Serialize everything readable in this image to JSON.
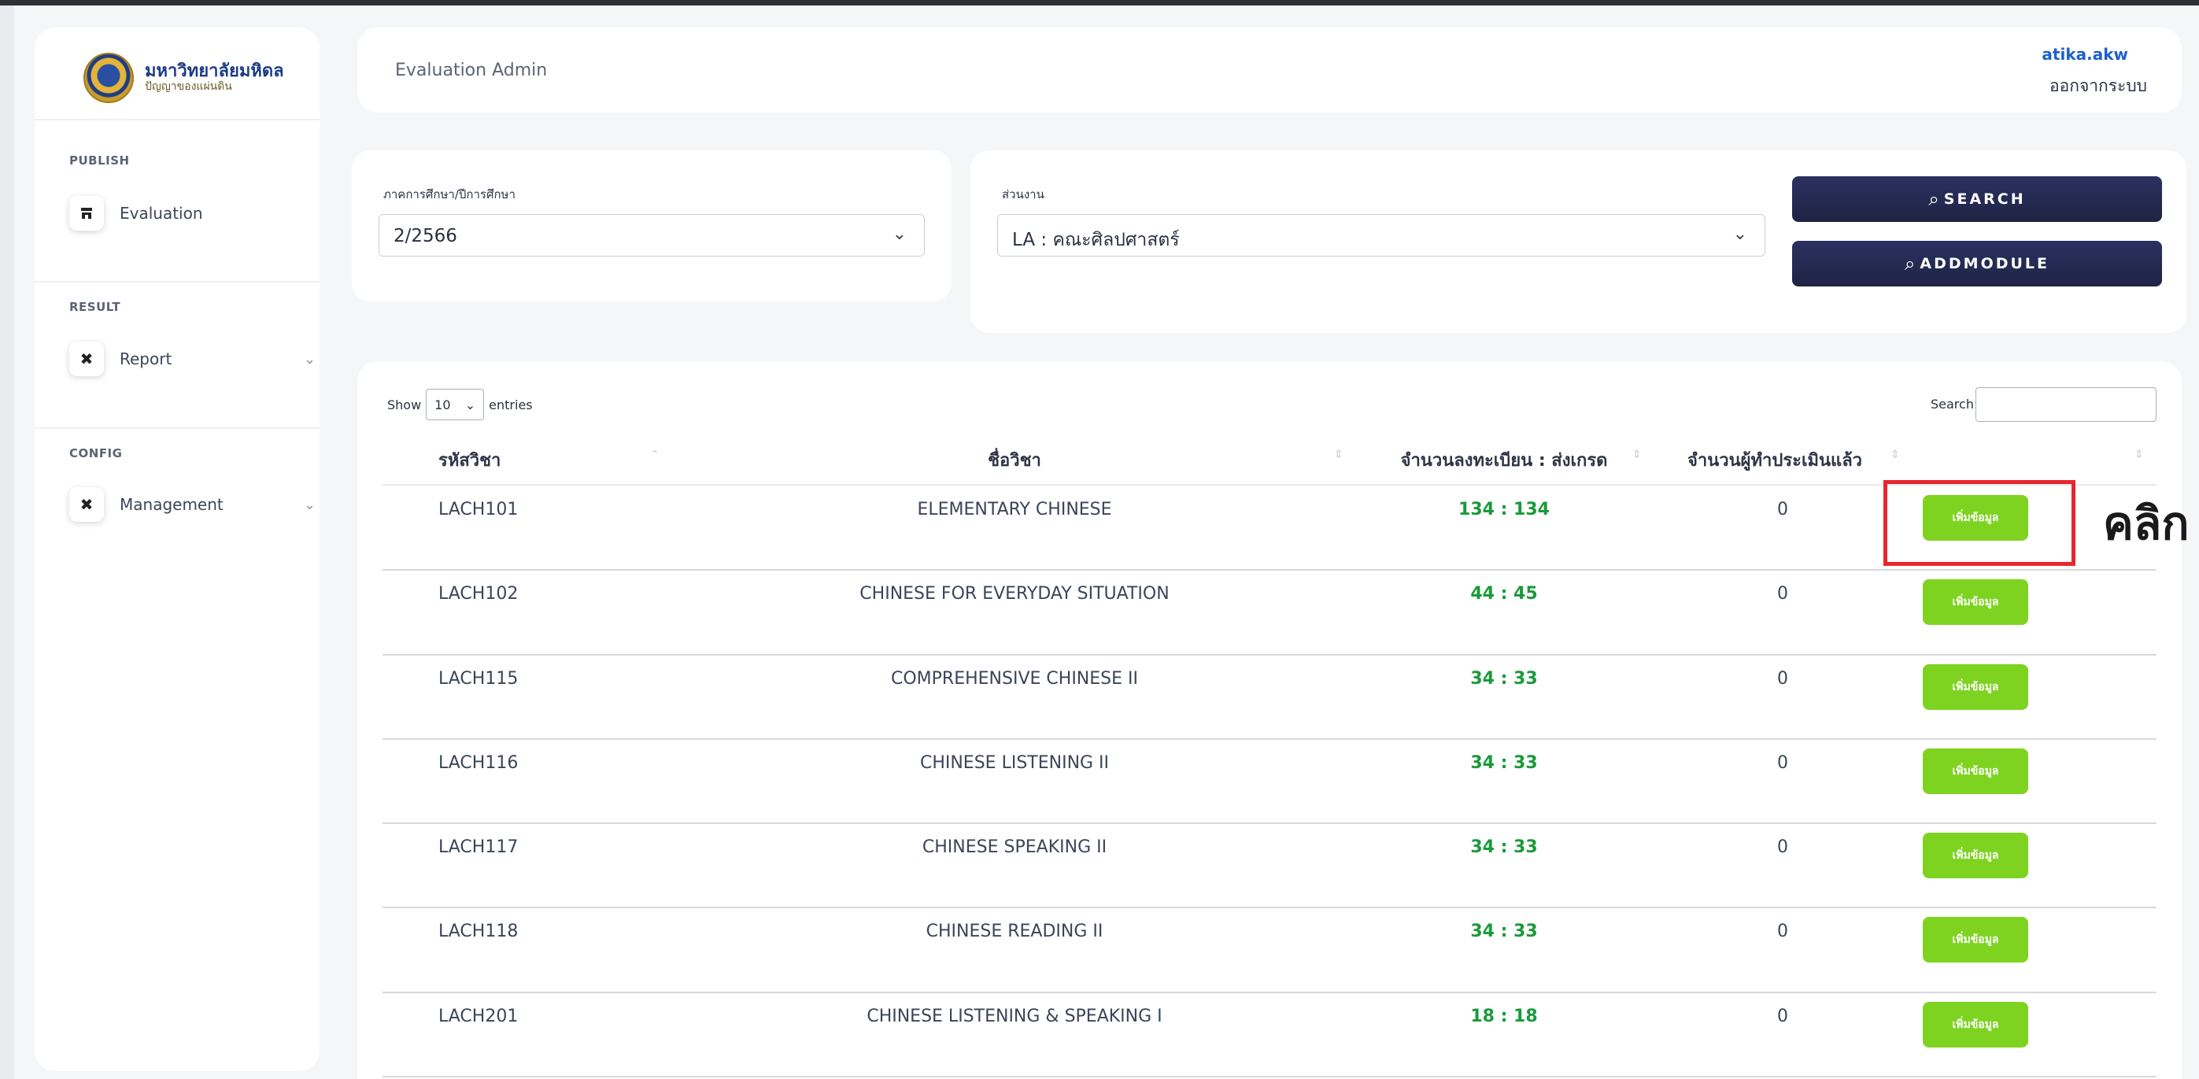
{
  "app": {
    "university_name": "มหาวิทยาลัยมหิดล",
    "university_motto": "ปัญญาของแผ่นดิน",
    "header_title": "Evaluation Admin",
    "user_name": "atika.akw",
    "logout_label": "ออกจากระบบ"
  },
  "sidebar": {
    "sections": [
      {
        "title": "PUBLISH",
        "items": [
          {
            "label": "Evaluation",
            "icon": "store-icon",
            "has_chevron": false
          }
        ]
      },
      {
        "title": "RESULT",
        "items": [
          {
            "label": "Report",
            "icon": "tools-icon",
            "has_chevron": true
          }
        ]
      },
      {
        "title": "CONFIG",
        "items": [
          {
            "label": "Management",
            "icon": "tools-icon",
            "has_chevron": true
          }
        ]
      }
    ]
  },
  "filters": {
    "term_label": "ภาคการศึกษา/ปีการศึกษา",
    "term_value": "2/2566",
    "unit_label": "ส่วนงาน",
    "unit_value": "LA : คณะศิลปศาสตร์",
    "search_button": "SEARCH",
    "addmodule_button": "ADDMODULE"
  },
  "table": {
    "show_label": "Show",
    "page_length": "10",
    "entries_label": "entries",
    "search_label": "Search:",
    "search_value": "",
    "columns": [
      "รหัสวิชา",
      "ชื่อวิชา",
      "จำนวนลงทะเบียน : ส่งเกรด",
      "จำนวนผู้ทำประเมินแล้ว"
    ],
    "rows": [
      {
        "code": "LACH101",
        "name": "ELEMENTARY CHINESE",
        "reg": "134 : 134",
        "evaluated": "0",
        "action": "เพิ่มข้อมูล"
      },
      {
        "code": "LACH102",
        "name": "CHINESE FOR EVERYDAY SITUATION",
        "reg": "44 : 45",
        "evaluated": "0",
        "action": "เพิ่มข้อมูล"
      },
      {
        "code": "LACH115",
        "name": "COMPREHENSIVE CHINESE II",
        "reg": "34 : 33",
        "evaluated": "0",
        "action": "เพิ่มข้อมูล"
      },
      {
        "code": "LACH116",
        "name": "CHINESE LISTENING II",
        "reg": "34 : 33",
        "evaluated": "0",
        "action": "เพิ่มข้อมูล"
      },
      {
        "code": "LACH117",
        "name": "CHINESE SPEAKING II",
        "reg": "34 : 33",
        "evaluated": "0",
        "action": "เพิ่มข้อมูล"
      },
      {
        "code": "LACH118",
        "name": "CHINESE READING II",
        "reg": "34 : 33",
        "evaluated": "0",
        "action": "เพิ่มข้อมูล"
      },
      {
        "code": "LACH201",
        "name": "CHINESE LISTENING & SPEAKING I",
        "reg": "18 : 18",
        "evaluated": "0",
        "action": "เพิ่มข้อมูล"
      }
    ]
  },
  "annotation": {
    "text": "คลิก",
    "highlight_color": "#e8262c"
  },
  "colors": {
    "accent_green": "#7ed321",
    "count_green": "#1a9a3a",
    "button_dark": "#1f2444",
    "user_blue": "#1f5fc9"
  }
}
